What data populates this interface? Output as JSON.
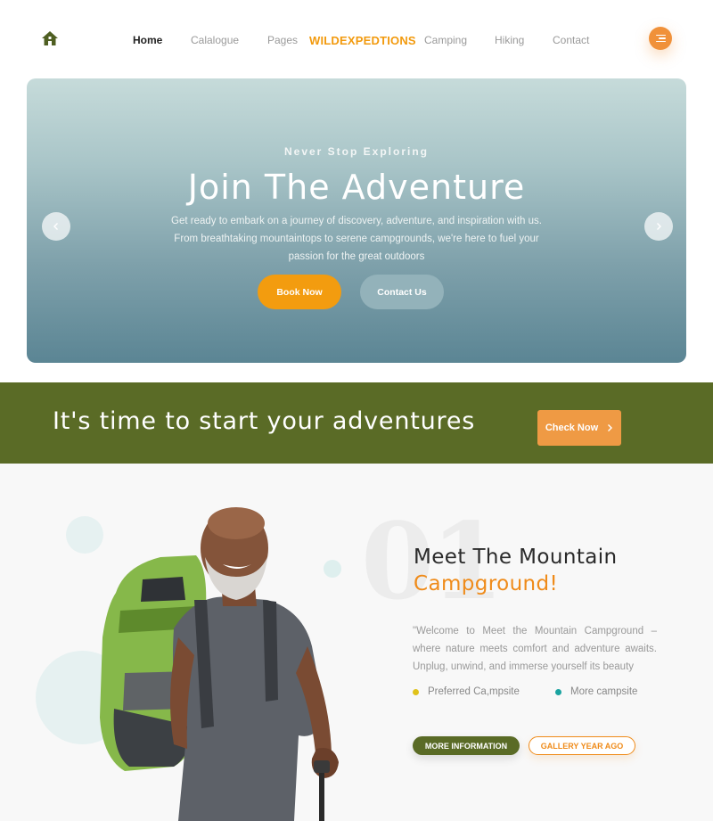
{
  "nav": {
    "links": [
      {
        "label": "Home"
      },
      {
        "label": "Calalogue"
      },
      {
        "label": "Pages"
      },
      {
        "label": "Camping"
      },
      {
        "label": "Hiking"
      },
      {
        "label": "Contact"
      }
    ],
    "brand": "WILDEXPEDTIONS",
    "home_icon": "home-icon",
    "menu_icon": "hamburger-menu-icon"
  },
  "hero": {
    "subtitle": "Never Stop Exploring",
    "title": "Join The Adventure",
    "description": "Get ready to embark on a journey of discovery, adventure, and inspiration with us. From breathtaking mountaintops to serene campgrounds, we're here to fuel your passion for the great outdoors",
    "book_label": "Book Now",
    "contact_label": "Contact Us",
    "prev_icon": "chevron-left-icon",
    "next_icon": "chevron-right-icon"
  },
  "banner": {
    "text": "It's time to start your adventures",
    "button_label": "Check Now"
  },
  "about": {
    "number": "01",
    "title_line1": "Meet The Mountain",
    "title_line2": "Campground!",
    "description": "\"Welcome to Meet the Mountain Campground – where nature meets comfort and adventure awaits. Unplug, unwind, and immerse yourself its beauty",
    "features": [
      {
        "label": "Preferred Ca,mpsite",
        "color": "#e0c21a"
      },
      {
        "label": "More campsite",
        "color": "#1aa3a0"
      }
    ],
    "more_label": "MORE INFORMATION",
    "gallery_label": "GALLERY YEAR AGO"
  },
  "colors": {
    "accent_orange": "#f39c0f",
    "brand_green": "#5a6b26",
    "button_orange": "#ef9a44"
  }
}
